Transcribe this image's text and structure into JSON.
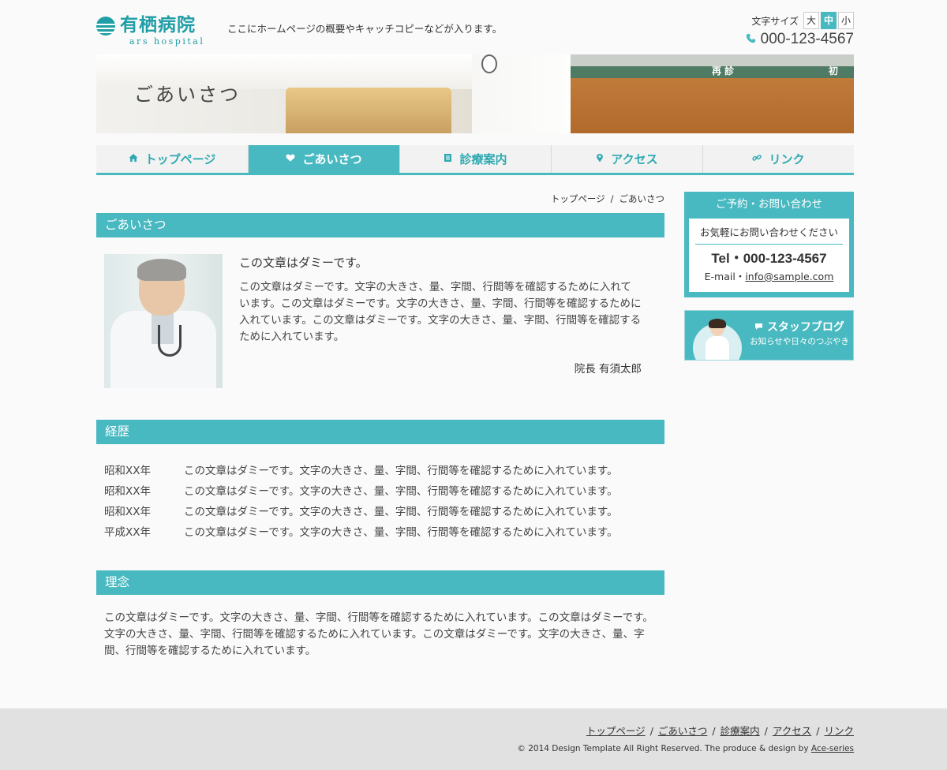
{
  "header": {
    "logo_name": "有栖病院",
    "logo_sub": "ars hospital",
    "catchcopy": "ここにホームページの概要やキャッチコピーなどが入ります。",
    "fontsize_label": "文字サイズ",
    "fontsize_options": [
      "大",
      "中",
      "小"
    ],
    "fontsize_selected": "中",
    "tel": "000-123-4567"
  },
  "hero": {
    "title": "ごあいさつ",
    "sign_1": "再 診",
    "sign_2": "初"
  },
  "nav": {
    "items": [
      {
        "label": "トップページ",
        "icon": "home-icon"
      },
      {
        "label": "ごあいさつ",
        "icon": "heart-icon"
      },
      {
        "label": "診療案内",
        "icon": "document-icon"
      },
      {
        "label": "アクセス",
        "icon": "map-pin-icon"
      },
      {
        "label": "リンク",
        "icon": "link-icon"
      }
    ],
    "active_index": 1
  },
  "breadcrumb": {
    "items": [
      "トップページ",
      "ごあいさつ"
    ],
    "separator": "/"
  },
  "greeting": {
    "heading": "ごあいさつ",
    "lead": "この文章はダミーです。",
    "body": "この文章はダミーです。文字の大きさ、量、字間、行間等を確認するために入れています。この文章はダミーです。文字の大きさ、量、字間、行間等を確認するために入れています。この文章はダミーです。文字の大きさ、量、字間、行間等を確認するために入れています。",
    "signature": "院長 有須太郎"
  },
  "history": {
    "heading": "経歴",
    "rows": [
      {
        "year": "昭和XX年",
        "text": "この文章はダミーです。文字の大きさ、量、字間、行間等を確認するために入れています。"
      },
      {
        "year": "昭和XX年",
        "text": "この文章はダミーです。文字の大きさ、量、字間、行間等を確認するために入れています。"
      },
      {
        "year": "昭和XX年",
        "text": "この文章はダミーです。文字の大きさ、量、字間、行間等を確認するために入れています。"
      },
      {
        "year": "平成XX年",
        "text": "この文章はダミーです。文字の大きさ、量、字間、行間等を確認するために入れています。"
      }
    ]
  },
  "philosophy": {
    "heading": "理念",
    "body": "この文章はダミーです。文字の大きさ、量、字間、行間等を確認するために入れています。この文章はダミーです。文字の大きさ、量、字間、行間等を確認するために入れています。この文章はダミーです。文字の大きさ、量、字間、行間等を確認するために入れています。"
  },
  "sidebar": {
    "contact_title": "ご予約・お問い合わせ",
    "contact_lead": "お気軽にお問い合わせください",
    "contact_tel": "Tel・000-123-4567",
    "contact_mail_label": "E-mail・",
    "contact_mail": "info@sample.com",
    "blog_title": "スタッフブログ",
    "blog_sub": "お知らせや日々のつぶやき"
  },
  "footer": {
    "nav": [
      "トップページ",
      "ごあいさつ",
      "診療案内",
      "アクセス",
      "リンク"
    ],
    "separator": "/",
    "copyright": "© 2014 Design Template All Right Reserved. The produce & design by ",
    "copyright_link": "Ace-series"
  },
  "colors": {
    "accent": "#48b9c1",
    "logo": "#1f9ea6",
    "footer_bg": "#e1e1e1"
  }
}
